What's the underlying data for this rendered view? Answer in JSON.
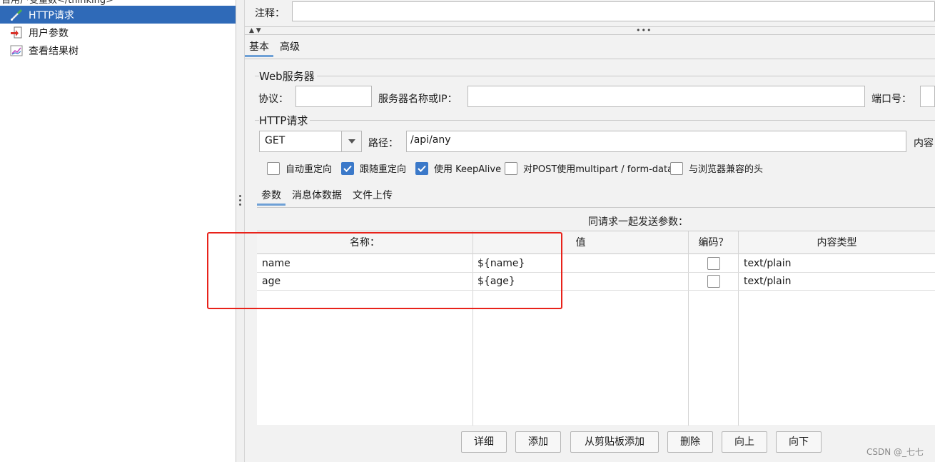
{
  "tree": {
    "partial_top_label": "自用户变量数</thinking>",
    "items": [
      {
        "label": "HTTP请求",
        "icon": "pipette-sampler-icon",
        "selected": true
      },
      {
        "label": "用户参数",
        "icon": "preprocessor-icon",
        "selected": false
      },
      {
        "label": "查看结果树",
        "icon": "listener-graph-icon",
        "selected": false
      }
    ]
  },
  "sampler": {
    "comment_label": "注释：",
    "comment_value": "",
    "tabs": {
      "basic": "基本",
      "advanced": "高级"
    },
    "web_server": {
      "title": "Web服务器",
      "protocol_label": "协议：",
      "protocol_value": "",
      "server_label": "服务器名称或IP：",
      "server_value": "",
      "port_label": "端口号："
    },
    "http_request": {
      "title": "HTTP请求",
      "method": "GET",
      "path_label": "路径：",
      "path_value": "/api/any",
      "content_label_partial": "内容"
    },
    "options": [
      {
        "label": "自动重定向",
        "checked": false
      },
      {
        "label": "跟随重定向",
        "checked": true
      },
      {
        "label": "使用 KeepAlive",
        "checked": true
      },
      {
        "label": "对POST使用multipart / form-data",
        "checked": false
      },
      {
        "label": "与浏览器兼容的头",
        "checked": false
      }
    ],
    "sub_tabs": {
      "params": "参数",
      "body": "消息体数据",
      "files": "文件上传"
    },
    "params_caption": "同请求一起发送参数：",
    "table": {
      "headers": {
        "name": "名称：",
        "value": "值",
        "encode": "编码？",
        "content_type": "内容类型"
      },
      "rows": [
        {
          "name": "name",
          "value": "${name}",
          "encode": false,
          "content_type": "text/plain"
        },
        {
          "name": "age",
          "value": "${age}",
          "encode": false,
          "content_type": "text/plain"
        }
      ]
    },
    "buttons": {
      "detail": "详细",
      "add": "添加",
      "add_clipboard": "从剪贴板添加",
      "delete": "删除",
      "up": "向上",
      "down": "向下"
    }
  },
  "colors": {
    "selection": "#2f6ab8",
    "checkbox_checked": "#3b79c9",
    "highlight_box": "#e8221a"
  },
  "watermark": "CSDN @_七七"
}
